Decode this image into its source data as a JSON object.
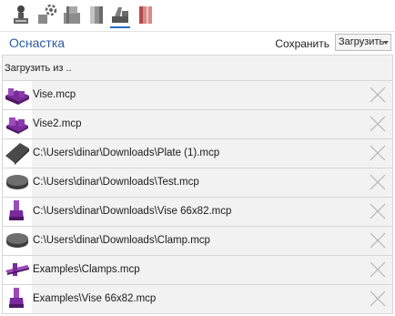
{
  "toolbar": {
    "buttons": [
      {
        "icon": "stock-person-icon"
      },
      {
        "icon": "gear-tool-icon"
      },
      {
        "icon": "stock-blocks-icon"
      },
      {
        "icon": "cylinder-icon"
      },
      {
        "icon": "fixture-icon",
        "active": true
      },
      {
        "icon": "red-block-icon"
      }
    ]
  },
  "header": {
    "title": "Оснастка",
    "save_label": "Сохранить",
    "load_label": "Загрузить"
  },
  "list": {
    "load_from_label": "Загрузить из ..",
    "items": [
      {
        "name": "Vise.mcp",
        "thumb": "vise-icon"
      },
      {
        "name": "Vise2.mcp",
        "thumb": "vise-icon"
      },
      {
        "name": "C:\\Users\\dinar\\Downloads\\Plate (1).mcp",
        "thumb": "plate-icon"
      },
      {
        "name": "C:\\Users\\dinar\\Downloads\\Test.mcp",
        "thumb": "disc-icon"
      },
      {
        "name": "C:\\Users\\dinar\\Downloads\\Vise 66x82.mcp",
        "thumb": "vise-upright-icon"
      },
      {
        "name": "C:\\Users\\dinar\\Downloads\\Clamp.mcp",
        "thumb": "disc-icon"
      },
      {
        "name": "Examples\\Clamps.mcp",
        "thumb": "clamp-bar-icon"
      },
      {
        "name": "Examples\\Vise 66x82.mcp",
        "thumb": "vise-upright-icon"
      }
    ]
  },
  "colors": {
    "title": "#2b5b9c",
    "fixture_purple": "#7a2a9a",
    "row_bg": "#f2f2f2"
  }
}
